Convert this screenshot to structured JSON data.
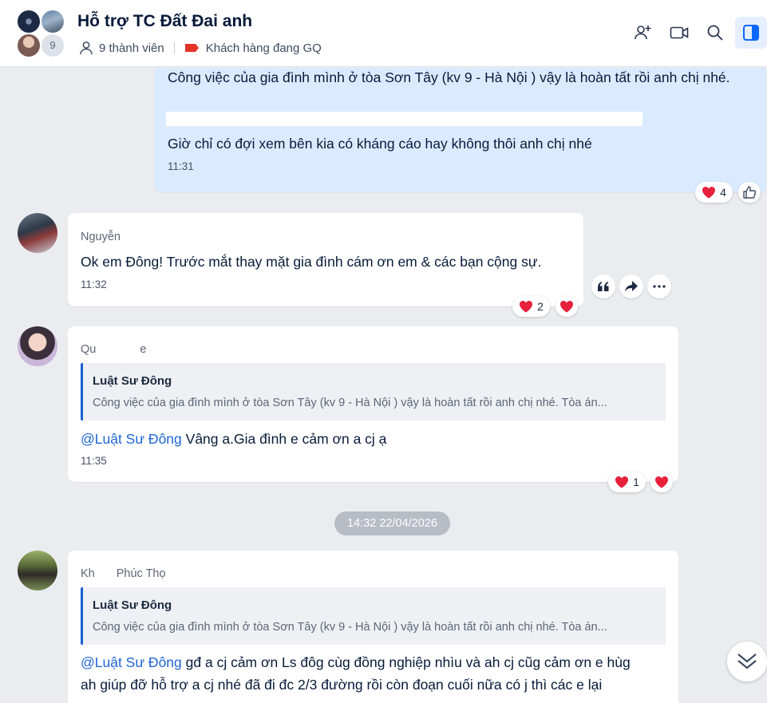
{
  "header": {
    "title": "Hỗ trợ TC Đất Đai anh",
    "member_count_badge": "9",
    "members_label": "9 thành viên",
    "tag_label": "Khách hàng đang GQ",
    "tag_color": "#e5332a",
    "icons": [
      "add-member-icon",
      "video-call-icon",
      "search-icon",
      "sidebar-toggle-icon"
    ]
  },
  "messages": [
    {
      "type": "outgoing",
      "lines": [
        "Công việc của gia đình mình ở tòa Sơn Tây (kv 9 - Hà Nội ) vậy là hoàn tất rồi anh chị nhé.",
        "Giờ chỉ có đợi xem bên kia có kháng cáo hay không thôi anh chị nhé"
      ],
      "time": "11:31",
      "reaction_count": "4"
    },
    {
      "type": "incoming",
      "sender": "Nguyễn",
      "text": "Ok em Đông! Trước mắt thay mặt gia đình cám ơn em & các bạn cộng sự.",
      "time": "11:32",
      "reaction_count": "2"
    },
    {
      "type": "incoming",
      "sender": "Qu",
      "sender_tail": "e",
      "quote_author": "Luật Sư Đông",
      "quote_text": "Công việc của gia đình mình ở tòa Sơn Tây (kv 9 - Hà Nội ) vậy là hoàn tất rồi anh chị nhé. Tòa án...",
      "mention": "@Luật Sư Đông",
      "text": " Vâng a.Gia đình e cảm ơn a cj ạ",
      "time": "11:35",
      "reaction_count": "1"
    },
    {
      "type": "incoming",
      "sender": "Kh",
      "sender_tail": "Phúc Thọ",
      "quote_author": "Luật Sư Đông",
      "quote_text": "Công việc của gia đình mình ở tòa Sơn Tây (kv 9 - Hà Nội ) vậy là hoàn tất rồi anh chị nhé. Tòa án...",
      "mention": "@Luật Sư Đông",
      "text_line1": " gđ a cj cảm ơn Ls đôg cùg đồng nghiệp nhìu và ah cj cũg cảm ơn e hùg",
      "text_line2": "ah giúp đỡ hỗ trợ a cj nhé đã đi đc 2/3 đường rồi còn đoạn cuối nữa có j thì các e lại"
    }
  ],
  "date_separator": "14:32 22/04/2026"
}
